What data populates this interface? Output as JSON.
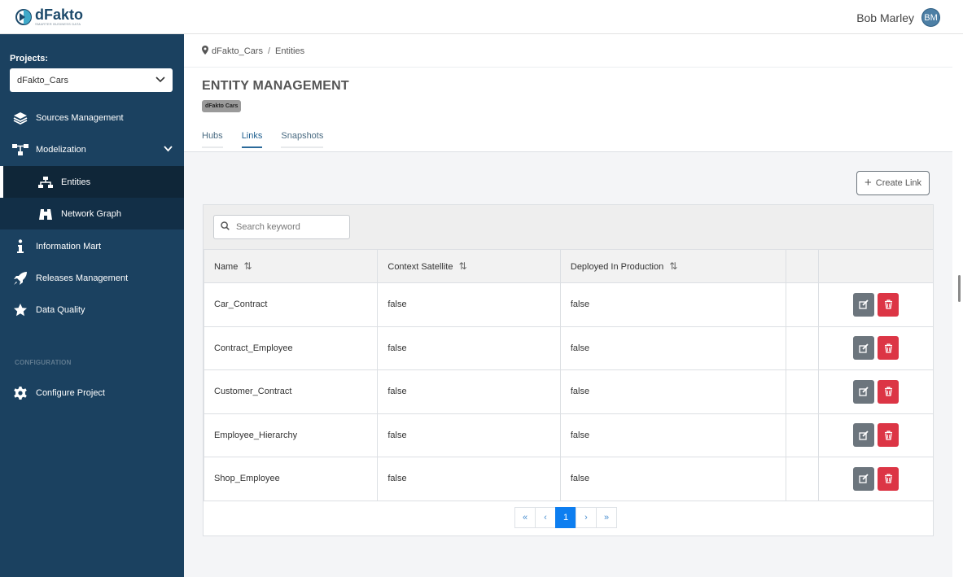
{
  "app": {
    "logo_name": "dFakto",
    "logo_tagline": "SMARTER BUSINESS DATA",
    "user_name": "Bob Marley",
    "user_initials": "BM"
  },
  "sidebar": {
    "projects_label": "Projects:",
    "selected_project": "dFakto_Cars",
    "items": [
      {
        "label": "Sources Management",
        "icon": "layers-icon"
      },
      {
        "label": "Modelization",
        "icon": "hierarchy-icon"
      },
      {
        "label": "Entities",
        "icon": "sitemap-icon"
      },
      {
        "label": "Network Graph",
        "icon": "binoculars-icon"
      },
      {
        "label": "Information Mart",
        "icon": "info-icon"
      },
      {
        "label": "Releases Management",
        "icon": "rocket-icon"
      },
      {
        "label": "Data Quality",
        "icon": "star-icon"
      }
    ],
    "config_label": "CONFIGURATION",
    "config_items": [
      {
        "label": "Configure Project",
        "icon": "gear-icon"
      }
    ]
  },
  "breadcrumb": {
    "project": "dFakto_Cars",
    "separator": "/",
    "current": "Entities"
  },
  "page": {
    "title": "ENTITY MANAGEMENT",
    "badge": "dFakto Cars",
    "tabs": [
      {
        "label": "Hubs",
        "active": false
      },
      {
        "label": "Links",
        "active": true
      },
      {
        "label": "Snapshots",
        "active": false
      }
    ],
    "create_label": "Create Link"
  },
  "search": {
    "placeholder": "Search keyword",
    "value": ""
  },
  "table": {
    "columns": [
      "Name",
      "Context Satellite",
      "Deployed In Production"
    ],
    "rows": [
      {
        "name": "Car_Contract",
        "context_satellite": "false",
        "deployed": "false"
      },
      {
        "name": "Contract_Employee",
        "context_satellite": "false",
        "deployed": "false"
      },
      {
        "name": "Customer_Contract",
        "context_satellite": "false",
        "deployed": "false"
      },
      {
        "name": "Employee_Hierarchy",
        "context_satellite": "false",
        "deployed": "false"
      },
      {
        "name": "Shop_Employee",
        "context_satellite": "false",
        "deployed": "false"
      }
    ]
  },
  "pagination": {
    "first": "«",
    "prev": "‹",
    "current": "1",
    "next": "›",
    "last": "»"
  },
  "colors": {
    "sidebar_bg": "#1b4160",
    "accent": "#0d7ef0",
    "delete": "#dc3545",
    "edit": "#6c757d"
  }
}
